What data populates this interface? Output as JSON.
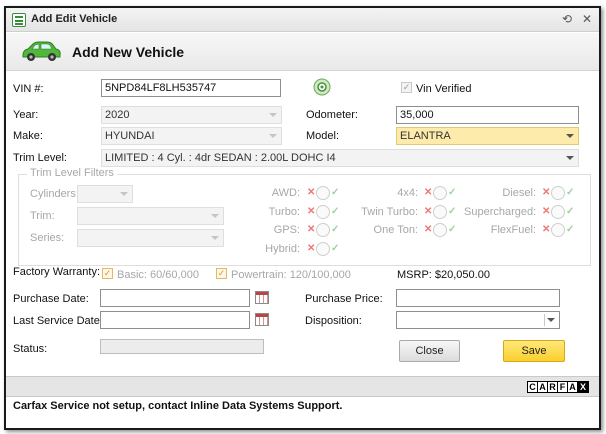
{
  "window": {
    "title": "Add Edit Vehicle"
  },
  "header": {
    "title": "Add New Vehicle"
  },
  "vin": {
    "label": "VIN #:",
    "value": "5NPD84LF8LH535747",
    "verified_label": "Vin Verified"
  },
  "year": {
    "label": "Year:",
    "value": "2020"
  },
  "make": {
    "label": "Make:",
    "value": "HYUNDAI"
  },
  "odometer": {
    "label": "Odometer:",
    "value": "35,000"
  },
  "model": {
    "label": "Model:",
    "value": "ELANTRA"
  },
  "trim_level": {
    "label": "Trim Level:",
    "value": "LIMITED : 4 Cyl. : 4dr SEDAN : 2.00L DOHC I4"
  },
  "filters": {
    "legend": "Trim Level Filters",
    "cylinders_label": "Cylinders:",
    "trim_label": "Trim:",
    "series_label": "Series:",
    "toggles": {
      "awd": "AWD:",
      "turbo": "Turbo:",
      "gps": "GPS:",
      "hybrid": "Hybrid:",
      "fourx4": "4x4:",
      "twin_turbo": "Twin Turbo:",
      "one_ton": "One Ton:",
      "diesel": "Diesel:",
      "supercharged": "Supercharged:",
      "flexfuel": "FlexFuel:"
    }
  },
  "warranty": {
    "label": "Factory Warranty:",
    "basic": "Basic: 60/60,000",
    "powertrain": "Powertrain: 120/100,000",
    "msrp": "MSRP: $20,050.00"
  },
  "purchase_date": {
    "label": "Purchase Date:",
    "value": ""
  },
  "last_service_date": {
    "label": "Last Service Date:",
    "value": ""
  },
  "purchase_price": {
    "label": "Purchase Price:",
    "value": ""
  },
  "disposition": {
    "label": "Disposition:",
    "value": ""
  },
  "status": {
    "label": "Status:",
    "value": ""
  },
  "buttons": {
    "close": "Close",
    "save": "Save"
  },
  "carfax": {
    "letters": [
      "C",
      "A",
      "R",
      "F",
      "A",
      "X"
    ]
  },
  "footer": {
    "message": "Carfax Service not setup, contact Inline Data Systems Support."
  },
  "colors": {
    "save_button": "#fbcf2d",
    "model_select": "#fcebaa",
    "toggle_x": "#ee7777",
    "toggle_check": "#9bd39b"
  }
}
